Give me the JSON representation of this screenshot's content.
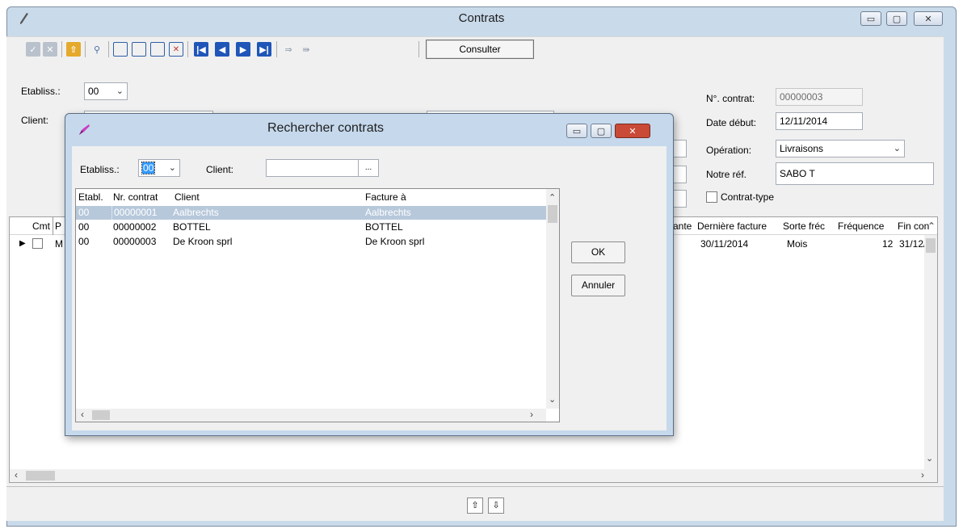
{
  "main": {
    "title": "Contrats",
    "toolbar": {
      "consult_label": "Consulter"
    },
    "form": {
      "etabliss_label": "Etabliss.:",
      "etabliss_value": "00",
      "client_label": "Client:",
      "contract_no_label": "N°. contrat:",
      "contract_no_value": "00000003",
      "start_label": "Date début:",
      "start_value": "12/11/2014",
      "operation_label": "Opération:",
      "operation_value": "Livraisons",
      "ref_label": "Notre réf.",
      "ref_value": "SABO T",
      "template_label": "Contrat-type"
    },
    "grid": {
      "headers": [
        "Cmt",
        "P",
        "ante",
        "Dernière facture",
        "Sorte fréc",
        "Fréquence",
        "Fin con"
      ],
      "row": {
        "pref": "M",
        "last_invoice": "30/11/2014",
        "sorte": "Mois",
        "frequence": "12",
        "fin": "31/12/:"
      }
    }
  },
  "dialog": {
    "title": "Rechercher contrats",
    "etabliss_label": "Etabliss.:",
    "etabliss_value": "00",
    "client_label": "Client:",
    "client_value": "",
    "ellipsis": "...",
    "columns": [
      "Etabl.",
      "Nr. contrat",
      "Client",
      "Facture à"
    ],
    "rows": [
      {
        "etabl": "00",
        "nr": "00000001",
        "client": "Aalbrechts",
        "facture": "Aalbrechts"
      },
      {
        "etabl": "00",
        "nr": "00000002",
        "client": "BOTTEL",
        "facture": "BOTTEL"
      },
      {
        "etabl": "00",
        "nr": "00000003",
        "client": "De Kroon sprl",
        "facture": "De Kroon sprl"
      }
    ],
    "ok_label": "OK",
    "cancel_label": "Annuler"
  },
  "colors": {
    "title_bar": "#c9daea",
    "selection": "#b7c8db",
    "close_red": "#c94a37"
  }
}
